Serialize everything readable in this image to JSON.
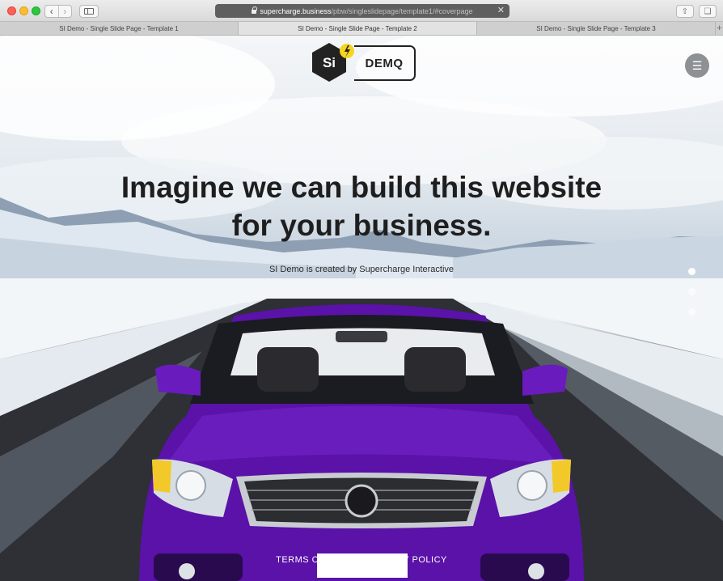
{
  "browser": {
    "url_domain": "supercharge.business",
    "url_path": "/pbw/singleslidepage/template1/#coverpage",
    "tabs": [
      {
        "label": "SI Demo - Single Slide Page - Template 1"
      },
      {
        "label": "SI Demo - Single Slide Page - Template 2"
      },
      {
        "label": "SI Demo - Single Slide Page - Template 3"
      }
    ],
    "new_tab": "+"
  },
  "logo": {
    "badge": "Si",
    "word": "DEMQ"
  },
  "hero": {
    "headline_line1": "Imagine we can build this website",
    "headline_line2": "for your business.",
    "subtitle": "SI Demo is created by Supercharge Interactive"
  },
  "footer": {
    "terms": "TERMS OF USE",
    "privacy": "PRIVACY POLICY"
  },
  "colors": {
    "car": "#5a12a8",
    "accent": "#f4d51f",
    "logo_dark": "#222222"
  },
  "icons": {
    "menu": "hamburger-icon",
    "lock": "lock-icon",
    "bolt": "lightning-icon"
  }
}
